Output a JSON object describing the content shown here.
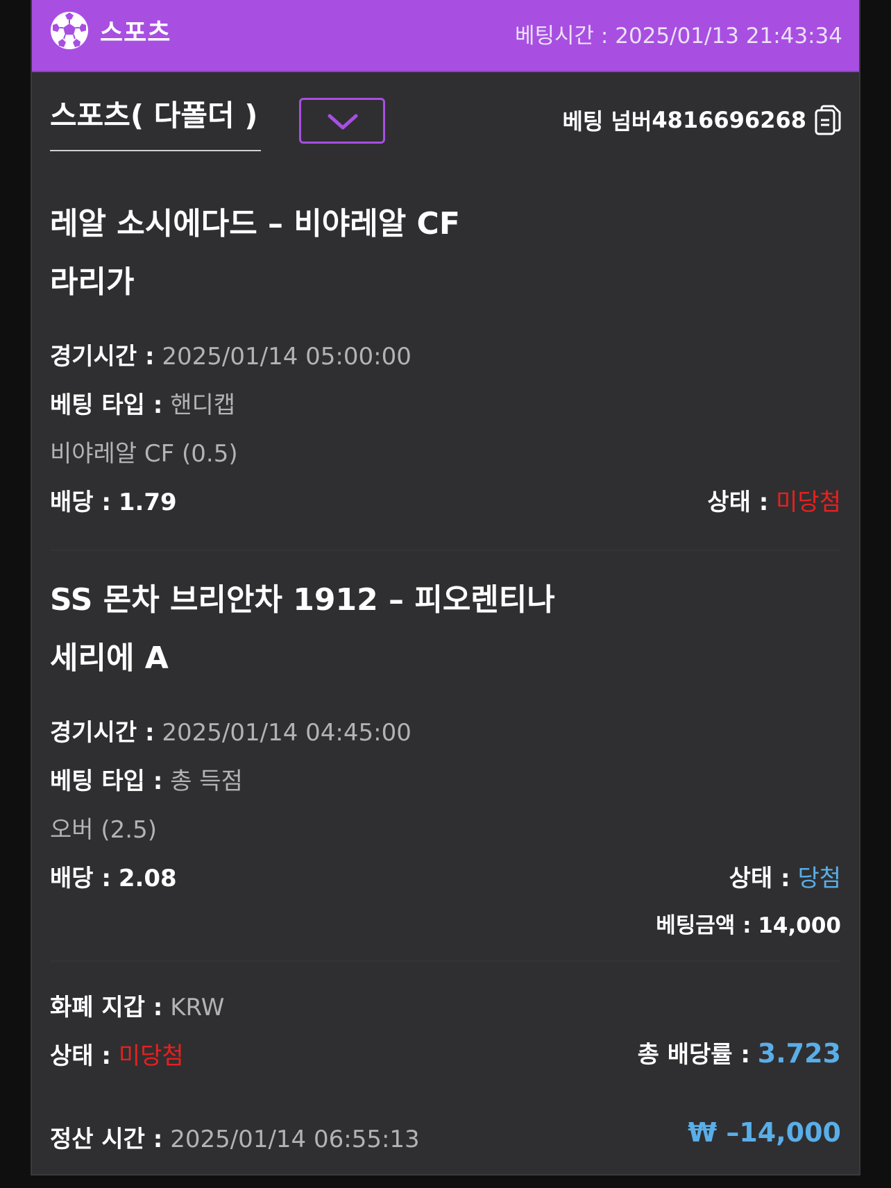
{
  "header": {
    "title": "스포츠",
    "bet_time_label": "베팅시간 :",
    "bet_time": "2025/01/13 21:43:34"
  },
  "bet_type": "스포츠( 다폴더 )",
  "bet_number_label": "베팅 넘버",
  "bet_number": "4816696268",
  "games": [
    {
      "match": "레알 소시에다드 – 비야레알 CF",
      "league": "라리가",
      "time_label": "경기시간 :",
      "time": "2025/01/14 05:00:00",
      "type_label": "베팅 타입 :",
      "type": "핸디캡",
      "pick": "비야레알 CF (0.5)",
      "odds_label": "배당 :",
      "odds": "1.79",
      "status_label": "상태 :",
      "status": "미당첨"
    },
    {
      "match": "SS 몬차 브리안차 1912 – 피오렌티나",
      "league": "세리에 A",
      "time_label": "경기시간 :",
      "time": "2025/01/14 04:45:00",
      "type_label": "베팅 타입 :",
      "type": "총 득점",
      "pick": "오버 (2.5)",
      "odds_label": "배당 :",
      "odds": "2.08",
      "status_label": "상태 :",
      "status": "당첨"
    }
  ],
  "bet_amount_label": "베팅금액 :",
  "bet_amount": "14,000",
  "summary": {
    "wallet_label": "화폐 지갑 :",
    "wallet": "KRW",
    "status_label": "상태 :",
    "status": "미당첨",
    "total_odds_label": "총 배당률 :",
    "total_odds": "3.723",
    "settle_label": "정산 시간 :",
    "settle_time": "2025/01/14 06:55:13",
    "payout": "₩ –14,000"
  },
  "colors": {
    "accent": "#a84fe2",
    "lose": "#e8201f",
    "win": "#5aaee8",
    "panel": "#2f2f31"
  },
  "icons": [
    "soccer-ball-icon",
    "chevron-down-icon",
    "copy-icon"
  ]
}
